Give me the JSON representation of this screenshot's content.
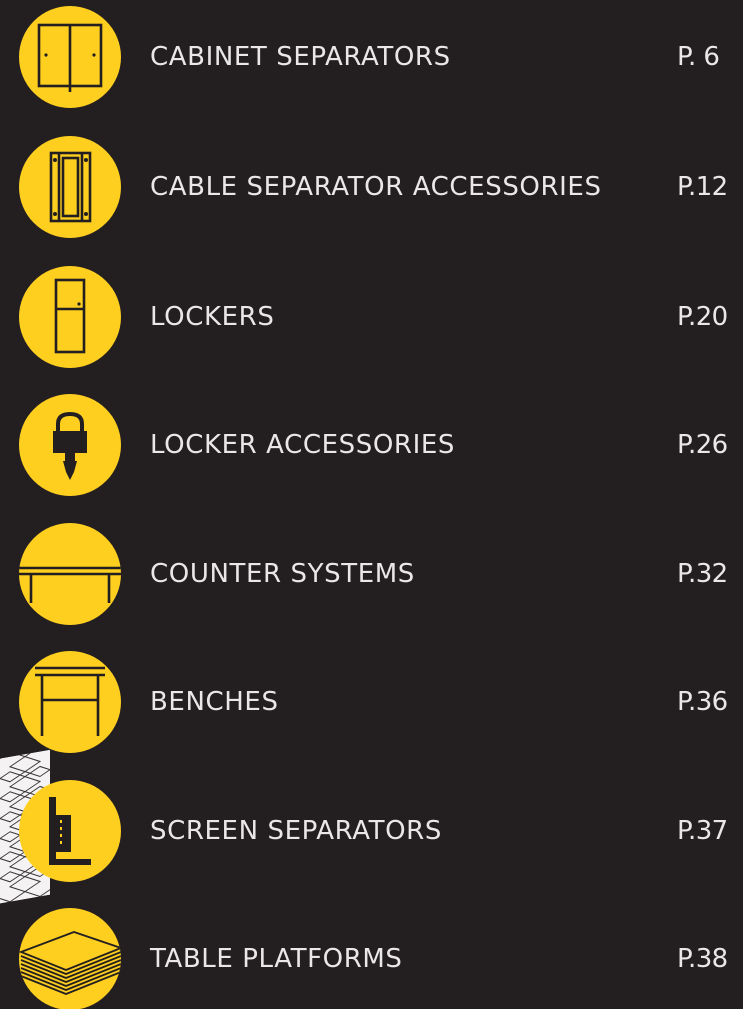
{
  "toc": {
    "items": [
      {
        "icon": "cabinet-icon",
        "label": "CABINET SEPARATORS",
        "page": "P. 6"
      },
      {
        "icon": "cable-separator-accessory-icon",
        "label": "CABLE SEPARATOR ACCESSORIES",
        "page": "P.12"
      },
      {
        "icon": "locker-icon",
        "label": "LOCKERS",
        "page": "P.20"
      },
      {
        "icon": "padlock-icon",
        "label": "LOCKER ACCESSORIES",
        "page": "P.26"
      },
      {
        "icon": "counter-icon",
        "label": "COUNTER SYSTEMS",
        "page": "P.32"
      },
      {
        "icon": "bench-icon",
        "label": "BENCHES",
        "page": "P.36"
      },
      {
        "icon": "screen-separator-icon",
        "label": "SCREEN SEPARATORS",
        "page": "P.37"
      },
      {
        "icon": "table-platform-icon",
        "label": "TABLE PLATFORMS",
        "page": "P.38"
      }
    ]
  },
  "colors": {
    "background": "#231f20",
    "accent_yellow": "#fecf1f",
    "text": "#e9e7e8",
    "icon_stroke": "#231f20"
  }
}
